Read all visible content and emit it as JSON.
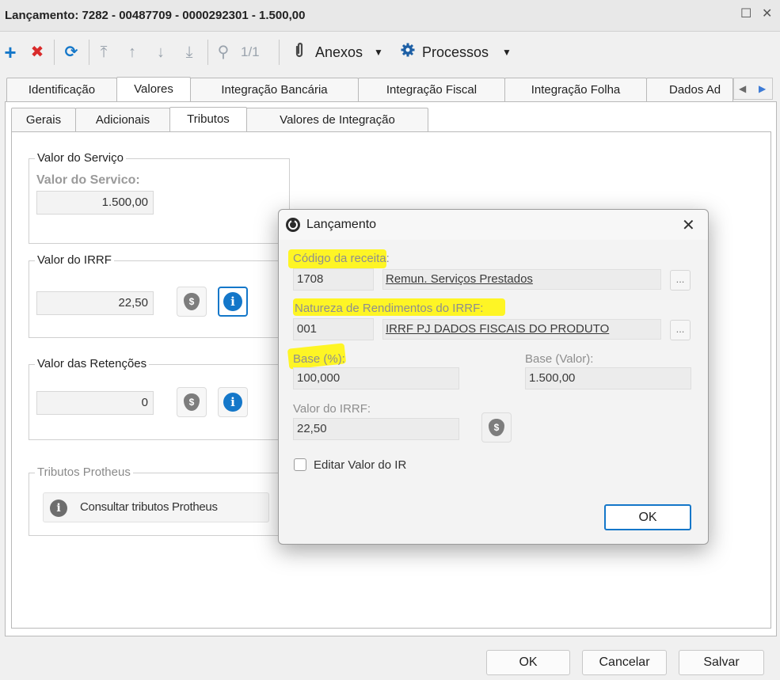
{
  "window": {
    "title": "Lançamento: 7282 - 00487709 - 0000292301 - 1.500,00",
    "maximize_glyph": "☐",
    "close_glyph": "✕"
  },
  "toolbar": {
    "add": "+",
    "delete": "✖",
    "refresh": "⟳",
    "first": "⤒",
    "up": "↑",
    "down": "↓",
    "last": "⤓",
    "search": "⚲",
    "pager": "1/1",
    "anexos": "Anexos",
    "processos": "Processos",
    "dropdown_glyph": "▼"
  },
  "tabs": [
    "Identificação",
    "Valores",
    "Integração Bancária",
    "Integração Fiscal",
    "Integração Folha",
    "Dados Ad"
  ],
  "tab_scroll": {
    "left": "◀",
    "right": "▶"
  },
  "subtabs": [
    "Gerais",
    "Adicionais",
    "Tributos",
    "Valores de Integração"
  ],
  "groups": {
    "servico": {
      "legend": "Valor do Serviço",
      "label": "Valor do Servico:",
      "value": "1.500,00"
    },
    "irrf": {
      "legend": "Valor do IRRF",
      "value": "22,50"
    },
    "retencoes": {
      "legend": "Valor das Retenções",
      "value": "0"
    },
    "protheus": {
      "legend": "Tributos Protheus",
      "button": "Consultar tributos Protheus"
    }
  },
  "icons": {
    "coin": "$",
    "info": "i"
  },
  "buttons": {
    "ok": "OK",
    "cancel": "Cancelar",
    "save": "Salvar"
  },
  "dialog": {
    "title": "Lançamento",
    "close_glyph": "✕",
    "codigo_label": "Código da receita:",
    "codigo_value": "1708",
    "codigo_desc": "Remun. Serviços Prestados",
    "natureza_label": "Natureza de Rendimentos do IRRF:",
    "natureza_value": "001",
    "natureza_desc": "IRRF PJ DADOS FISCAIS DO PRODUTO",
    "ellipsis": "...",
    "base_pct_label": "Base (%):",
    "base_pct_value": "100,000",
    "base_val_label": "Base (Valor):",
    "base_val_value": "1.500,00",
    "irrf_label": "Valor do IRRF:",
    "irrf_value": "22,50",
    "checkbox_label": "Editar Valor do IR",
    "ok": "OK"
  },
  "colors": {
    "accent": "#1477c9",
    "danger": "#d92b2b",
    "highlight": "#fff500"
  }
}
